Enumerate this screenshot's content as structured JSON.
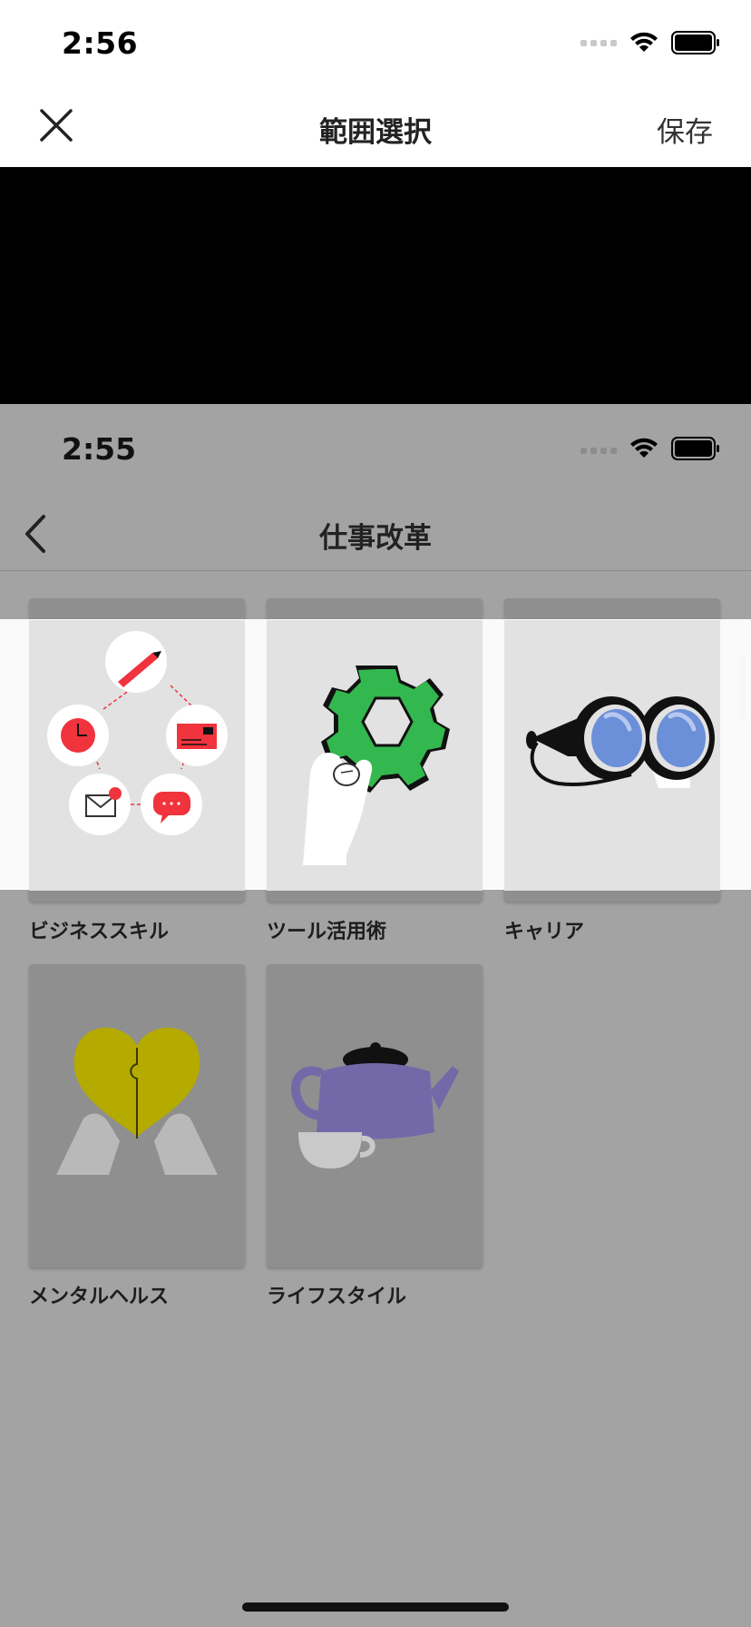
{
  "status_bar": {
    "time": "2:56"
  },
  "nav": {
    "title": "範囲選択",
    "save_label": "保存"
  },
  "inner_screen": {
    "status_time": "2:55",
    "title": "仕事改革",
    "categories": [
      {
        "label": "ビジネススキル",
        "icon": "business-skills-illustration"
      },
      {
        "label": "ツール活用術",
        "icon": "gear-in-hand-illustration"
      },
      {
        "label": "キャリア",
        "icon": "binoculars-illustration"
      },
      {
        "label": "メンタルヘルス",
        "icon": "heart-puzzle-illustration"
      },
      {
        "label": "ライフスタイル",
        "icon": "teapot-illustration"
      }
    ]
  },
  "colors": {
    "accent_red": "#f0333c",
    "gear_green": "#33b84f",
    "lens_blue": "#6b8fd8",
    "heart_yellow": "#b5aa00",
    "teapot_purple": "#7469a8"
  }
}
